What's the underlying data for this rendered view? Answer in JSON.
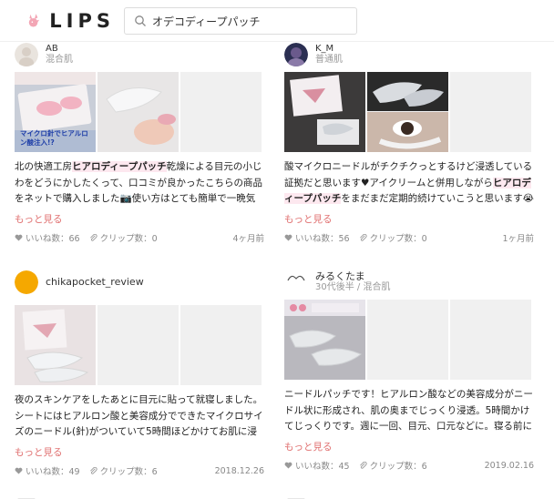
{
  "app": {
    "brand": "LIPS"
  },
  "search": {
    "query": "オデコディープパッチ"
  },
  "labels": {
    "more": "もっと見る"
  },
  "posts": [
    {
      "user": "AB",
      "skin": "混合肌",
      "body_pre": "北の快適工房",
      "body_hl": "ヒアロディープパッチ",
      "body_post": "乾燥による目元の小じわをどうにかしたくって、口コミが良かったこちらの商品をネットで購入しました📷使い方はとても簡単で一晩気になる目元やほうれい線に貼るだけで、…",
      "likes": "いいね数：66",
      "clips": "クリップ数：0",
      "date": "4ヶ月前",
      "thumb1_text": "マイクロ針でヒアルロン酸注入!?"
    },
    {
      "user": "K_M",
      "skin": "普通肌",
      "body_pre": "酸マイクロニードルがチクチクっとするけど浸透している証拠だと思います♥アイクリームと併用しながら",
      "body_hl": "ヒアロディープパッチ",
      "body_post": "をまだまだ定期的続けていこうと思います😭🙌#ヒアロディープパッチ#定期的#…",
      "likes": "いいね数：56",
      "clips": "クリップ数：0",
      "date": "1ヶ月前"
    },
    {
      "user": "chikapocket_review",
      "skin": "",
      "body_pre": "夜のスキンケアをしたあとに目元に貼って就寝しました。シートにはヒアルロン酸と美容成分でできたマイクロサイズのニードル(針)がついていて5時間ほどかけてお肌に浸透していきます。朝起きて目元がピンと…",
      "body_hl": "",
      "body_post": "",
      "likes": "いいね数：49",
      "clips": "クリップ数：6",
      "date": "2018.12.26"
    },
    {
      "user": "みるくたま",
      "skin": "30代後半 / 混合肌",
      "body_pre": "ニードルパッチです！ヒアルロン酸などの美容成分がニードル状に形成され、肌の奥までじっくり浸透。5時間かけてじっくりです。週に一回、目元、口元などに。寝る前に貼ります面白いー！と思いながらいざ…",
      "body_hl": "",
      "body_post": "",
      "likes": "いいね数：45",
      "clips": "クリップ数：6",
      "date": "2019.02.16"
    }
  ],
  "colors": {
    "highlight": "#fde8ef",
    "more": "#e07070",
    "brand_pink": "#f3a6b5"
  },
  "icons": [
    "lips-rabbit-logo",
    "search-icon",
    "heart-icon",
    "clip-icon"
  ]
}
